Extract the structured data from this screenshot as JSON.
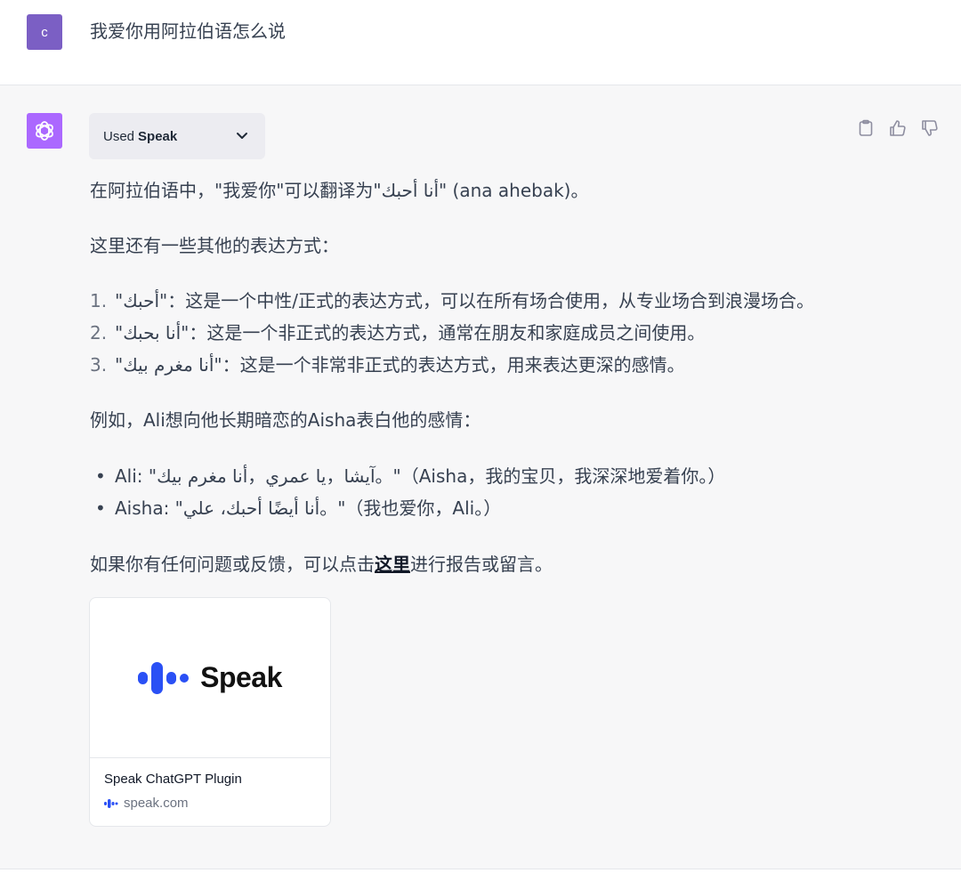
{
  "user": {
    "avatar_letter": "c",
    "message": "我爱你用阿拉伯语怎么说"
  },
  "assistant": {
    "plugin": {
      "used_label": "Used",
      "plugin_name": "Speak"
    },
    "p1": "在阿拉伯语中，\"我爱你\"可以翻译为\"أنا أحبك\" (ana ahebak)。",
    "p2": "这里还有一些其他的表达方式：",
    "ordered_list": [
      {
        "num": "1.",
        "text": "\"أحبك\"：这是一个中性/正式的表达方式，可以在所有场合使用，从专业场合到浪漫场合。"
      },
      {
        "num": "2.",
        "text": "\"أنا بحبك\"：这是一个非正式的表达方式，通常在朋友和家庭成员之间使用。"
      },
      {
        "num": "3.",
        "text": "\"أنا مغرم بيك\"：这是一个非常非正式的表达方式，用来表达更深的感情。"
      }
    ],
    "p3": "例如，Ali想向他长期暗恋的Aisha表白他的感情：",
    "unordered_list": [
      {
        "bullet": "•",
        "text": "Ali: \"آيشا，يا عمري，أنا مغرم بيك。\"（Aisha，我的宝贝，我深深地爱着你。）"
      },
      {
        "bullet": "•",
        "text": "Aisha: \"أنا أيضًا أحبك، علي。\"（我也爱你，Ali。）"
      }
    ],
    "p4_before": "如果你有任何问题或反馈，可以点击",
    "p4_link": "这里",
    "p4_after": "进行报告或留言。"
  },
  "card": {
    "logo_text": "Speak",
    "title": "Speak ChatGPT Plugin",
    "domain": "speak.com"
  },
  "icons": {
    "copy": "clipboard-icon",
    "like": "thumbs-up-icon",
    "dislike": "thumbs-down-icon",
    "chevron": "chevron-down-icon"
  },
  "colors": {
    "user_avatar": "#7b5fc4",
    "gpt_avatar": "#ab68ff",
    "speak_blue": "#2a50f5",
    "assistant_bg": "#f7f7f8"
  }
}
